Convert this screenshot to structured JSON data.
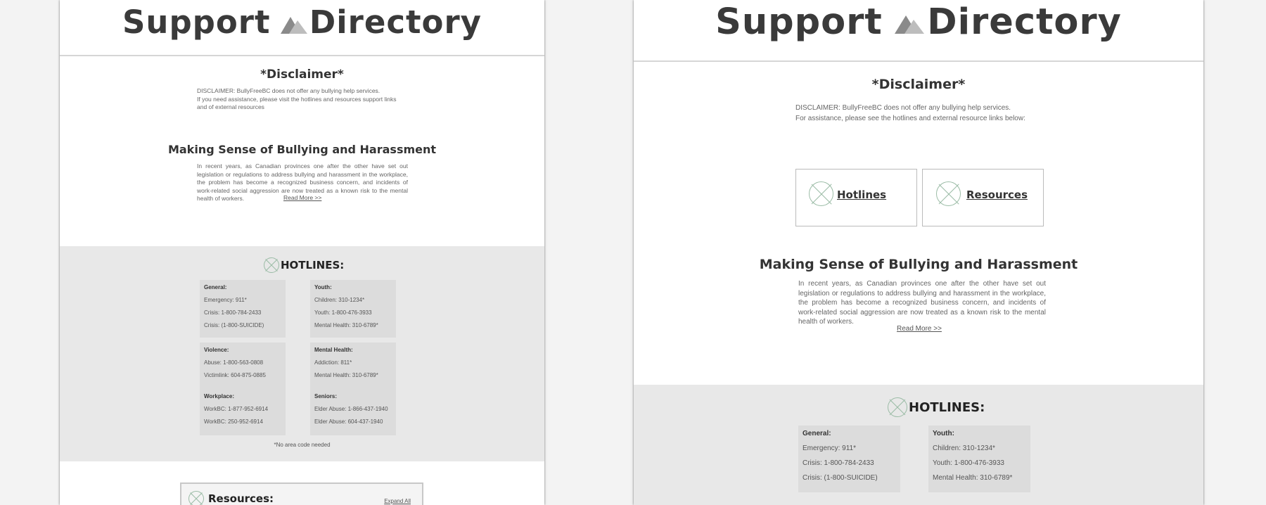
{
  "left": {
    "title_left": "Support",
    "title_right": "Directory",
    "disclaimer_heading": "*Disclaimer*",
    "disclaimer_line1": "DISCLAIMER: BullyFreeBC does not offer any bullying help services.",
    "disclaimer_line2": "If you need assistance, please visit the hotlines and resources support links",
    "disclaimer_line3": "and  of external resources",
    "section_heading": "Making Sense of Bullying and Harassment",
    "paragraph": "In recent years, as Canadian provinces one after the other have set out legislation or regulations to address bullying and harassment in the workplace, the problem has become a recognized business concern, and incidents of work-related social aggression are now treated as a known risk to the mental health of workers.",
    "read_more": "Read More >>",
    "hotlines_heading": "HOTLINES:",
    "cards": [
      {
        "title": "General:",
        "lines": [
          "Emergency: 911*",
          "Crisis: 1-800-784-2433",
          "Crisis: (1-800-SUICIDE)"
        ]
      },
      {
        "title": "Youth:",
        "lines": [
          "Children: 310-1234*",
          "Youth: 1-800-476-3933",
          "Mental Health: 310-6789*"
        ]
      },
      {
        "title": "Violence:",
        "lines": [
          "Abuse: 1-800-563-0808",
          "Victimlink: 604-875-0885"
        ]
      },
      {
        "title": "Mental Health:",
        "lines": [
          "Addiction: 811*",
          "Mental Health: 310-6789*"
        ]
      },
      {
        "title": "Workplace:",
        "lines": [
          "WorkBC: 1-877-952-6914",
          "WorkBC: 250-952-6914"
        ]
      },
      {
        "title": "Seniors:",
        "lines": [
          "Elder Abuse: 1-866-437-1940",
          "Elder Abuse: 604-437-1940"
        ]
      }
    ],
    "footnote": "*No area code needed",
    "resources_heading": "Resources:",
    "expand_all": "Expand All"
  },
  "right": {
    "title_left": "Support",
    "title_right": "Directory",
    "disclaimer_heading": "*Disclaimer*",
    "disclaimer_line1": "DISCLAIMER: BullyFreeBC does not offer any bullying help services.",
    "disclaimer_line2": "For assistance, please see the hotlines and external resource links below:",
    "hotlines_link": "Hotlines",
    "resources_link": "Resources",
    "section_heading": "Making Sense of Bullying and Harassment",
    "paragraph": "In recent years, as Canadian provinces one after the other have set out legislation or regulations to address bullying and harassment in the workplace, the problem has become a recognized business concern, and incidents of work-related social aggression are now treated as a known risk to the mental health of workers.",
    "read_more": "Read More >>",
    "hotlines_heading": "HOTLINES:",
    "cards": [
      {
        "title": "General:",
        "lines": [
          "Emergency: 911*",
          "Crisis: 1-800-784-2433",
          "Crisis: (1-800-SUICIDE)"
        ]
      },
      {
        "title": "Youth:",
        "lines": [
          "Children: 310-1234*",
          "Youth: 1-800-476-3933",
          "Mental Health: 310-6789*"
        ]
      }
    ]
  },
  "icons": {
    "logo": "mountain-logo-icon",
    "placeholder": "x-placeholder-icon"
  },
  "colors": {
    "background": "#f3f3f3",
    "gray_section": "#e8e8e8",
    "card": "#dcdcdc",
    "icon": "#9bbca6",
    "text": "#333333"
  }
}
